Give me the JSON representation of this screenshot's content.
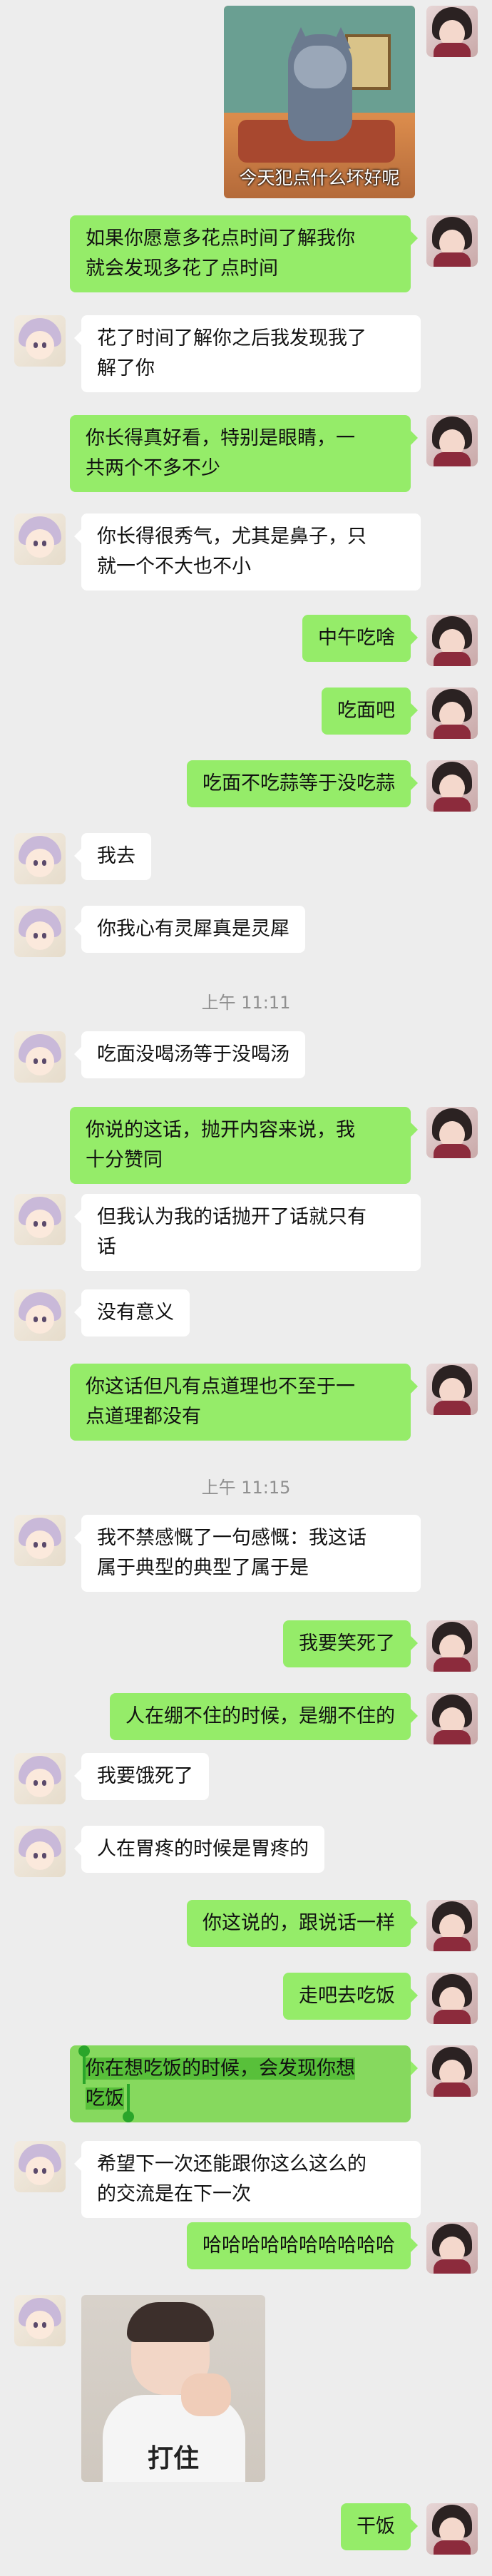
{
  "messages": [
    {
      "side": "right",
      "type": "sticker",
      "caption": "今天犯点什么坏好呢"
    },
    {
      "side": "right",
      "type": "text",
      "lines": [
        "如果你愿意多花点时间了解我你",
        "就会发现多花了点时间"
      ]
    },
    {
      "side": "left",
      "type": "text",
      "lines": [
        "花了时间了解你之后我发现我了",
        "解了你"
      ]
    },
    {
      "side": "right",
      "type": "text",
      "lines": [
        "你长得真好看，特别是眼睛，一",
        "共两个不多不少"
      ]
    },
    {
      "side": "left",
      "type": "text",
      "lines": [
        "你长得很秀气，尤其是鼻子，只",
        "就一个不大也不小"
      ]
    },
    {
      "side": "right",
      "type": "text",
      "lines": [
        "中午吃啥"
      ]
    },
    {
      "side": "right",
      "type": "text",
      "lines": [
        "吃面吧"
      ]
    },
    {
      "side": "right",
      "type": "text",
      "lines": [
        "吃面不吃蒜等于没吃蒜"
      ]
    },
    {
      "side": "left",
      "type": "text",
      "lines": [
        "我去"
      ]
    },
    {
      "side": "left",
      "type": "text",
      "lines": [
        "你我心有灵犀真是灵犀"
      ]
    },
    {
      "type": "time",
      "text": "上午 11:11"
    },
    {
      "side": "left",
      "type": "text",
      "lines": [
        "吃面没喝汤等于没喝汤"
      ]
    },
    {
      "side": "right",
      "type": "text",
      "lines": [
        "你说的这话，抛开内容来说，我",
        "十分赞同"
      ]
    },
    {
      "side": "left",
      "type": "text",
      "lines": [
        "但我认为我的话抛开了话就只有",
        "话"
      ]
    },
    {
      "side": "left",
      "type": "text",
      "lines": [
        "没有意义"
      ]
    },
    {
      "side": "right",
      "type": "text",
      "lines": [
        "你这话但凡有点道理也不至于一",
        "点道理都没有"
      ]
    },
    {
      "type": "time",
      "text": "上午 11:15"
    },
    {
      "side": "left",
      "type": "text",
      "lines": [
        "我不禁感慨了一句感慨：我这话",
        "属于典型的典型了属于是"
      ]
    },
    {
      "side": "right",
      "type": "text",
      "lines": [
        "我要笑死了"
      ]
    },
    {
      "side": "right",
      "type": "text",
      "lines": [
        "人在绷不住的时候，是绷不住的"
      ]
    },
    {
      "side": "left",
      "type": "text",
      "lines": [
        "我要饿死了"
      ]
    },
    {
      "side": "left",
      "type": "text",
      "lines": [
        "人在胃疼的时候是胃疼的"
      ]
    },
    {
      "side": "right",
      "type": "text",
      "lines": [
        "你这说的，跟说话一样"
      ]
    },
    {
      "side": "right",
      "type": "text",
      "lines": [
        "走吧去吃饭"
      ]
    },
    {
      "side": "right",
      "type": "text",
      "selected": true,
      "lines": [
        "你在想吃饭的时候，会发现你想",
        "吃饭"
      ]
    },
    {
      "side": "left",
      "type": "text",
      "lines": [
        "希望下一次还能跟你这么这么的",
        "的交流是在下一次"
      ]
    },
    {
      "side": "right",
      "type": "text",
      "lines": [
        "哈哈哈哈哈哈哈哈哈哈"
      ]
    },
    {
      "side": "left",
      "type": "sticker",
      "caption": "打住"
    },
    {
      "side": "right",
      "type": "text",
      "lines": [
        "干饭"
      ]
    }
  ]
}
